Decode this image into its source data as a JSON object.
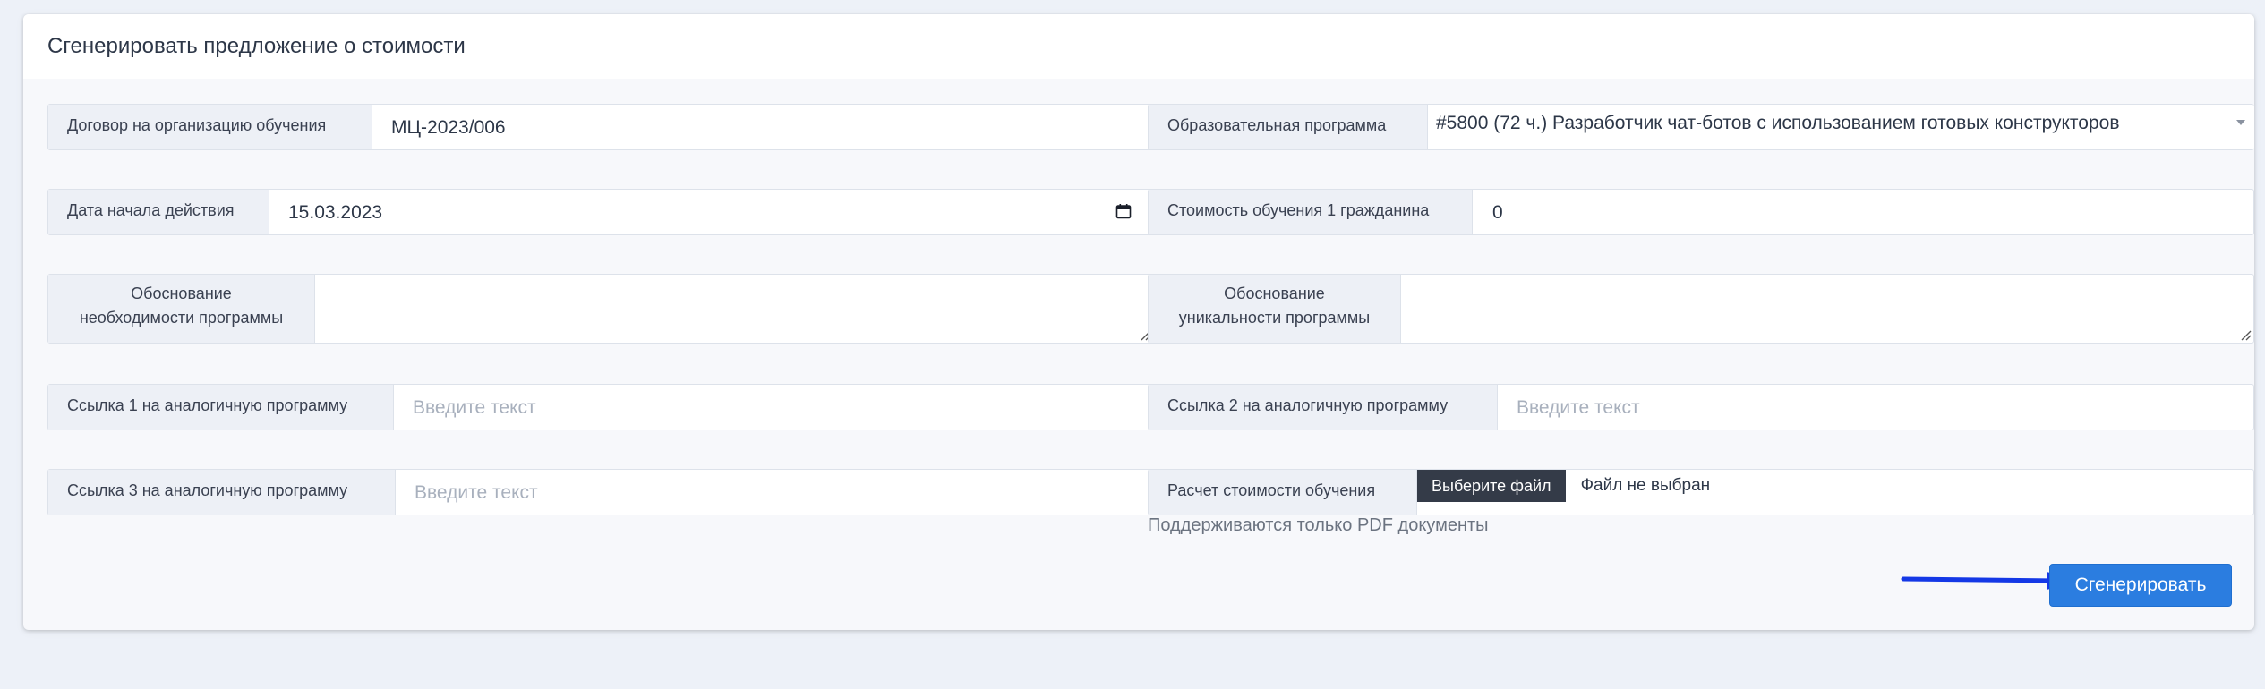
{
  "form": {
    "title": "Сгенерировать предложение о стоимости",
    "contract": {
      "label": "Договор на организацию обучения",
      "value": "МЦ-2023/006"
    },
    "program": {
      "label": "Образовательная программа",
      "value": "#5800 (72 ч.) Разработчик чат-ботов с использованием готовых конструкторов"
    },
    "start_date": {
      "label": "Дата начала действия",
      "value": "15.03.2023"
    },
    "cost_per_citizen": {
      "label": "Стоимость обучения 1 гражданина",
      "value": "0"
    },
    "justification_need": {
      "label_line1": "Обоснование",
      "label_line2": "необходимости программы",
      "value": ""
    },
    "justification_unique": {
      "label_line1": "Обоснование",
      "label_line2": "уникальности программы",
      "value": ""
    },
    "link1": {
      "label": "Ссылка 1 на аналогичную программу",
      "placeholder": "Введите текст"
    },
    "link2": {
      "label": "Ссылка 2 на аналогичную программу",
      "placeholder": "Введите текст"
    },
    "link3": {
      "label": "Ссылка 3 на аналогичную программу",
      "placeholder": "Введите текст"
    },
    "cost_calc": {
      "label": "Расчет стоимости обучения",
      "choose_button": "Выберите файл",
      "status": "Файл не выбран",
      "hint": "Поддерживаются только PDF документы"
    },
    "submit_label": "Сгенерировать"
  },
  "colors": {
    "accent": "#2b7de0",
    "annotation_arrow": "#1438e6",
    "file_button": "#343b48"
  },
  "icons": [
    "calendar-icon",
    "dropdown-arrow-icon",
    "resize-grip-icon",
    "annotation-arrow"
  ]
}
